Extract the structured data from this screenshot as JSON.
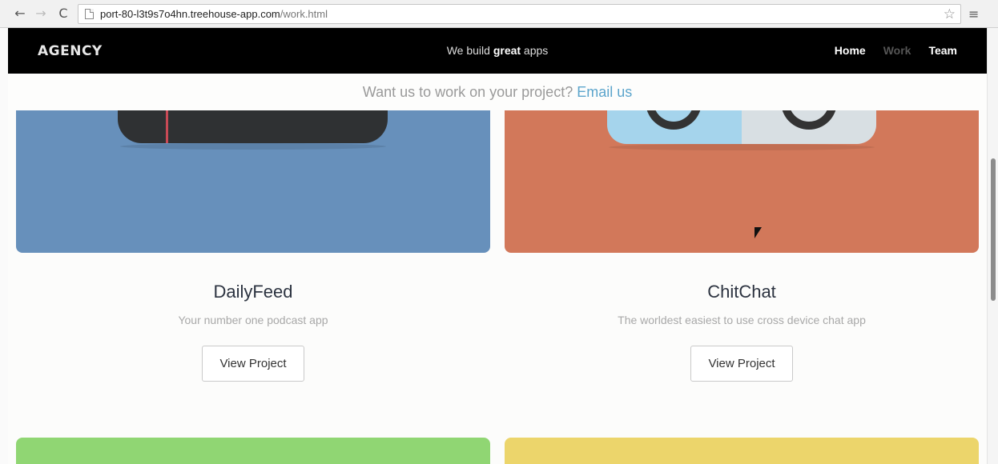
{
  "browser": {
    "url_host": "port-80-l3t9s7o4hn.treehouse-app.com",
    "url_path": "/work.html",
    "back_icon": "←",
    "forward_icon": "→",
    "reload_icon": "C",
    "bookmark_icon": "☆",
    "menu_icon": "≡"
  },
  "header": {
    "logo": "AGENCY",
    "tagline_prefix": "We build ",
    "tagline_bold": "great",
    "tagline_suffix": " apps",
    "nav": [
      {
        "label": "Home"
      },
      {
        "label": "Work"
      },
      {
        "label": "Team"
      }
    ]
  },
  "cta": {
    "text": "Want us to work on your project? ",
    "link": "Email us"
  },
  "projects": [
    {
      "title": "DailyFeed",
      "description": "Your number one podcast app",
      "button": "View Project",
      "color": "#6790bb"
    },
    {
      "title": "ChitChat",
      "description": "The worldest easiest to use cross device chat app",
      "button": "View Project",
      "color": "#d2785a"
    }
  ],
  "next_row_colors": [
    "#90d673",
    "#ecd56b"
  ]
}
